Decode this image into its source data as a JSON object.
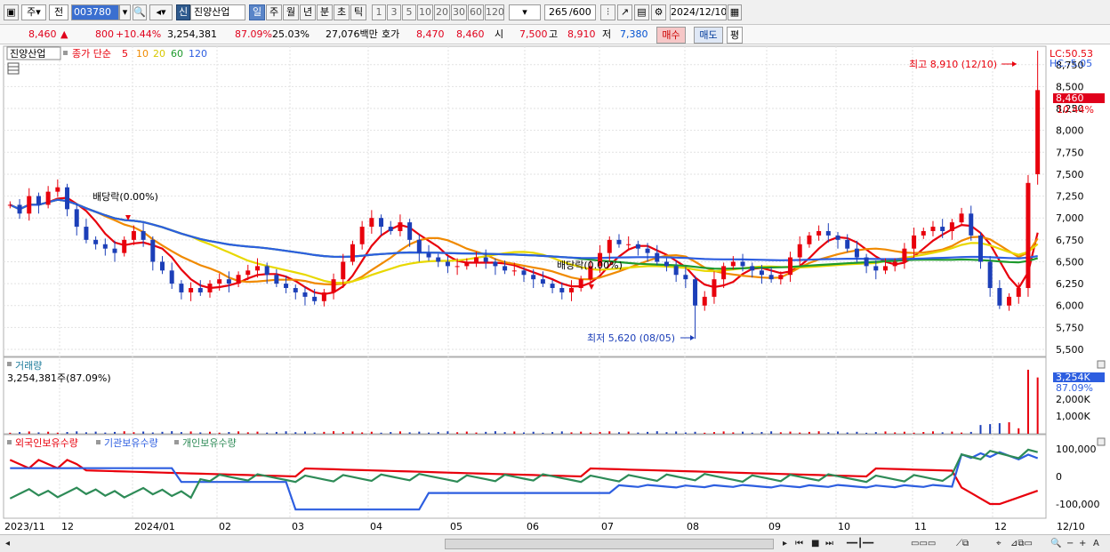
{
  "toolbar": {
    "market": "주",
    "period_type": "전",
    "code": "003780",
    "badge": "신",
    "stock_name": "진양산업",
    "periods": [
      "일",
      "주",
      "월",
      "년",
      "분",
      "초",
      "틱"
    ],
    "intervals": [
      "1",
      "3",
      "5",
      "10",
      "20",
      "30",
      "60",
      "120"
    ],
    "count": "265",
    "count_max": "/600",
    "date": "2024/12/10"
  },
  "quote": {
    "price": "8,460",
    "change_arrow": "▲",
    "change": "800",
    "change_pct": "+10.44%",
    "volume": "3,254,381",
    "vol_ratio": "87.09%",
    "turnover": "25.03%",
    "amount": "27,076백만",
    "hoga_label": "호가",
    "ask": "8,470",
    "bid": "8,460",
    "open_label": "시",
    "open": "7,500",
    "high_label": "고",
    "high": "8,910",
    "low_label": "저",
    "low": "7,380",
    "buy_button": "매수",
    "sell_button": "매도",
    "eval_button": "평"
  },
  "price_panel": {
    "name": "진양산업",
    "ma_label": "종가 단순",
    "ma_periods": [
      "5",
      "10",
      "20",
      "60",
      "120"
    ],
    "ma_colors": [
      "#e8000c",
      "#f08a00",
      "#e8d800",
      "#1e9a2c",
      "#2d5ee0"
    ],
    "lc": "LC:50.53",
    "hc": "HC:-5.05",
    "y_ticks": [
      "8,750",
      "8,500",
      "8,250",
      "8,000",
      "7,750",
      "7,500",
      "7,250",
      "7,000",
      "6,750",
      "6,500",
      "6,250",
      "6,000",
      "5,750",
      "5,500"
    ],
    "current_tag": "8,460",
    "current_pct": "10.44%",
    "high_note": "최고 8,910 (12/10)",
    "low_note": "최저 5,620 (08/05)",
    "dividend_1": "배당락(0.00%)",
    "dividend_2": "배당락(0.00%)"
  },
  "volume_panel": {
    "title": "거래량",
    "value": "3,254,381주(87.09%)",
    "tag": "3,254K",
    "tag_pct": "87.09%",
    "y_ticks": [
      "2,000K",
      "1,000K"
    ]
  },
  "holdings_panel": {
    "series": [
      "외국인보유수량",
      "기관보유수량",
      "개인보유수량"
    ],
    "colors": [
      "#e8000c",
      "#2d5ee0",
      "#2e8b57"
    ],
    "y_ticks": [
      "100,000",
      "0",
      "-100,000"
    ]
  },
  "x_axis": [
    "2023/11",
    "12",
    "2024/01",
    "02",
    "03",
    "04",
    "05",
    "06",
    "07",
    "08",
    "09",
    "10",
    "11",
    "12",
    "12/10"
  ],
  "chart_data": {
    "type": "candlestick",
    "x_range": [
      "2023/11",
      "2024/12/10"
    ],
    "y_range": [
      5500,
      8900
    ],
    "closes": [
      7150,
      7050,
      7250,
      7150,
      7300,
      7350,
      7100,
      6900,
      6750,
      6700,
      6650,
      6600,
      6750,
      6850,
      6750,
      6500,
      6400,
      6250,
      6150,
      6200,
      6150,
      6250,
      6300,
      6250,
      6350,
      6400,
      6450,
      6350,
      6250,
      6200,
      6150,
      6100,
      6050,
      6150,
      6300,
      6500,
      6700,
      6900,
      7000,
      6900,
      6850,
      6950,
      6750,
      6600,
      6550,
      6500,
      6450,
      6450,
      6500,
      6550,
      6500,
      6450,
      6400,
      6400,
      6350,
      6300,
      6250,
      6200,
      6150,
      6200,
      6300,
      6450,
      6600,
      6750,
      6700,
      6700,
      6650,
      6600,
      6500,
      6450,
      6350,
      6300,
      6000,
      6100,
      6300,
      6450,
      6500,
      6450,
      6400,
      6350,
      6300,
      6350,
      6550,
      6700,
      6800,
      6850,
      6800,
      6750,
      6650,
      6550,
      6450,
      6400,
      6450,
      6500,
      6650,
      6800,
      6850,
      6900,
      6850,
      6950,
      7050,
      6800,
      6500,
      6200,
      6000,
      6100,
      6200,
      7400,
      8460
    ]
  }
}
